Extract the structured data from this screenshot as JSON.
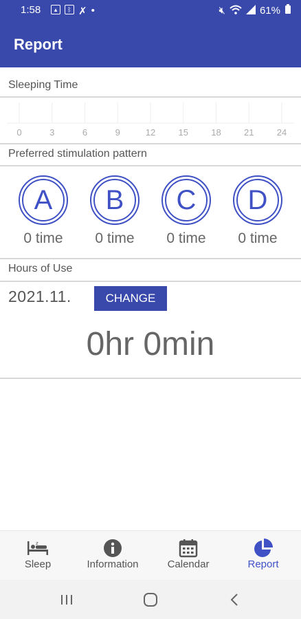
{
  "status": {
    "time": "1:58",
    "battery": "61%"
  },
  "appbar": {
    "title": "Report"
  },
  "sleeping": {
    "label": "Sleeping Time",
    "ticks": [
      "0",
      "3",
      "6",
      "9",
      "12",
      "15",
      "18",
      "21",
      "24"
    ]
  },
  "patterns": {
    "label": "Preferred stimulation pattern",
    "items": [
      {
        "letter": "A",
        "count": "0 time"
      },
      {
        "letter": "B",
        "count": "0 time"
      },
      {
        "letter": "C",
        "count": "0 time"
      },
      {
        "letter": "D",
        "count": "0 time"
      }
    ]
  },
  "usage": {
    "label": "Hours of Use",
    "month": "2021.11.",
    "change_label": "CHANGE",
    "total": "0hr 0min"
  },
  "nav": [
    {
      "label": "Sleep",
      "icon": "bed-icon"
    },
    {
      "label": "Information",
      "icon": "info-icon"
    },
    {
      "label": "Calendar",
      "icon": "calendar-icon"
    },
    {
      "label": "Report",
      "icon": "pie-chart-icon"
    }
  ],
  "colors": {
    "primary": "#3949ab",
    "accent": "#3f51c5"
  }
}
